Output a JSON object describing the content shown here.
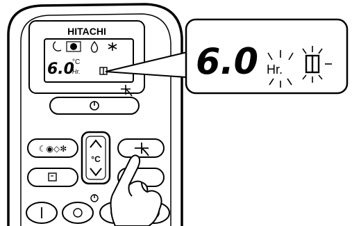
{
  "brand": "HITACHI",
  "lcd": {
    "mode_icons": [
      "sleep-moon-icon",
      "auto-circle-icon",
      "dry-drop-icon",
      "heat-snowflake-icon"
    ],
    "time_value": "6.0",
    "temp_unit": "°C",
    "hours_unit": "Hr."
  },
  "zoom": {
    "value": "6.0",
    "unit": "Hr."
  },
  "buttons": {
    "mode_label": "☾◉◇✻",
    "temp_unit_label": "°C",
    "power_symbol": "⏻"
  }
}
